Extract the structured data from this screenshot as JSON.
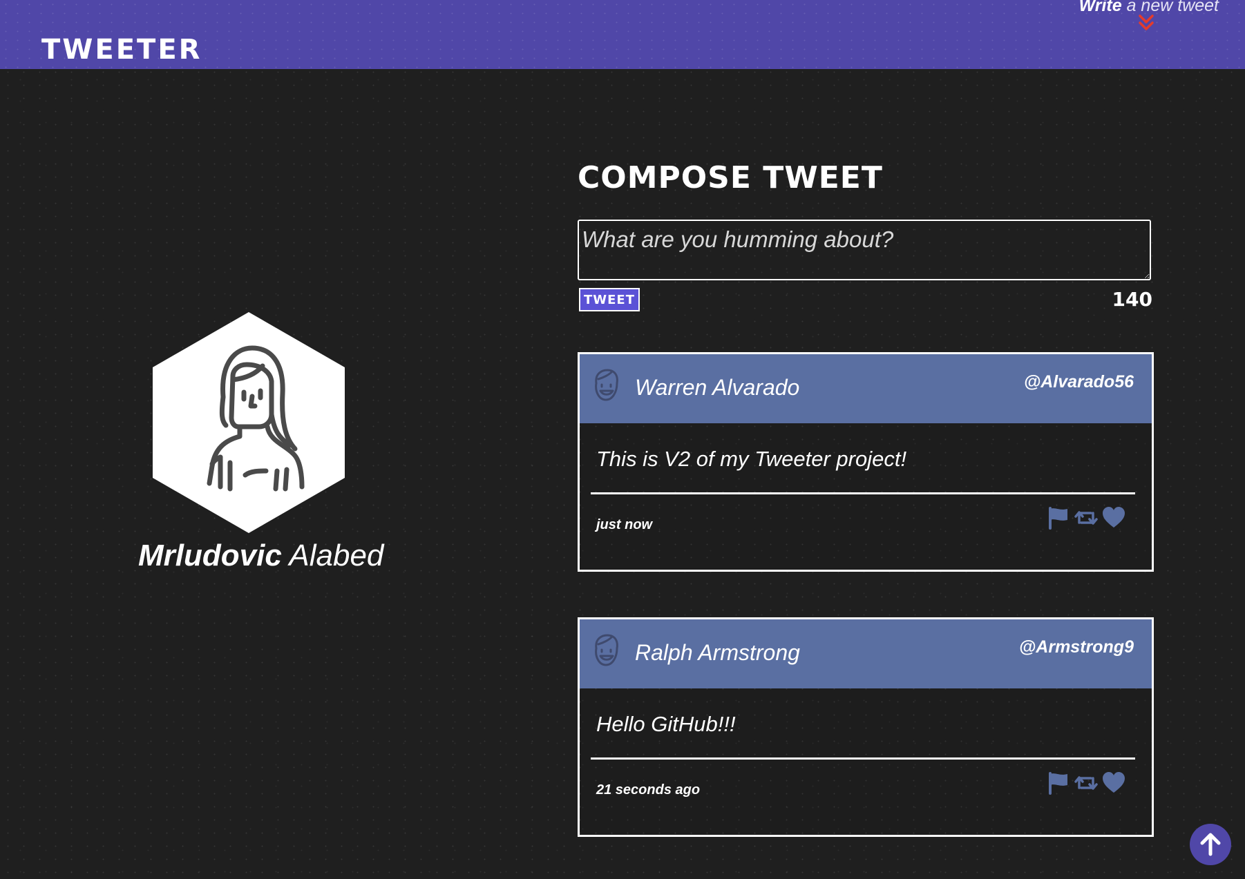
{
  "nav": {
    "brand": "TWEETER",
    "write_bold": "Write",
    "write_rest": " a new tweet",
    "chevron_icon": "double-chevron-down-icon",
    "chevron_color": "#e53b2c"
  },
  "profile": {
    "first_name": "Mrludovic",
    "last_name": "Alabed",
    "avatar_icon": "woman-avatar-icon"
  },
  "compose": {
    "title": "COMPOSE TWEET",
    "placeholder": "What are you humming about?",
    "button_label": "TWEET",
    "counter": "140"
  },
  "tweets": [
    {
      "name": "Warren Alvarado",
      "handle": "@Alvarado56",
      "content": "This is V2 of my Tweeter project!",
      "time": "just now",
      "avatar_icon": "smiling-face-avatar-icon"
    },
    {
      "name": "Ralph Armstrong",
      "handle": "@Armstrong9",
      "content": "Hello GitHub!!!",
      "time": "21 seconds ago",
      "avatar_icon": "smiling-face-avatar-icon"
    }
  ],
  "actions": [
    "flag-icon",
    "retweet-icon",
    "heart-icon"
  ],
  "colors": {
    "nav_bg": "#5047a8",
    "tweet_header_bg": "#5a6fa2",
    "button_bg": "#5b52d6",
    "action_icon": "#5a6fa2",
    "page_bg": "#1f1f1f"
  },
  "scroll_top_icon": "arrow-up-icon"
}
